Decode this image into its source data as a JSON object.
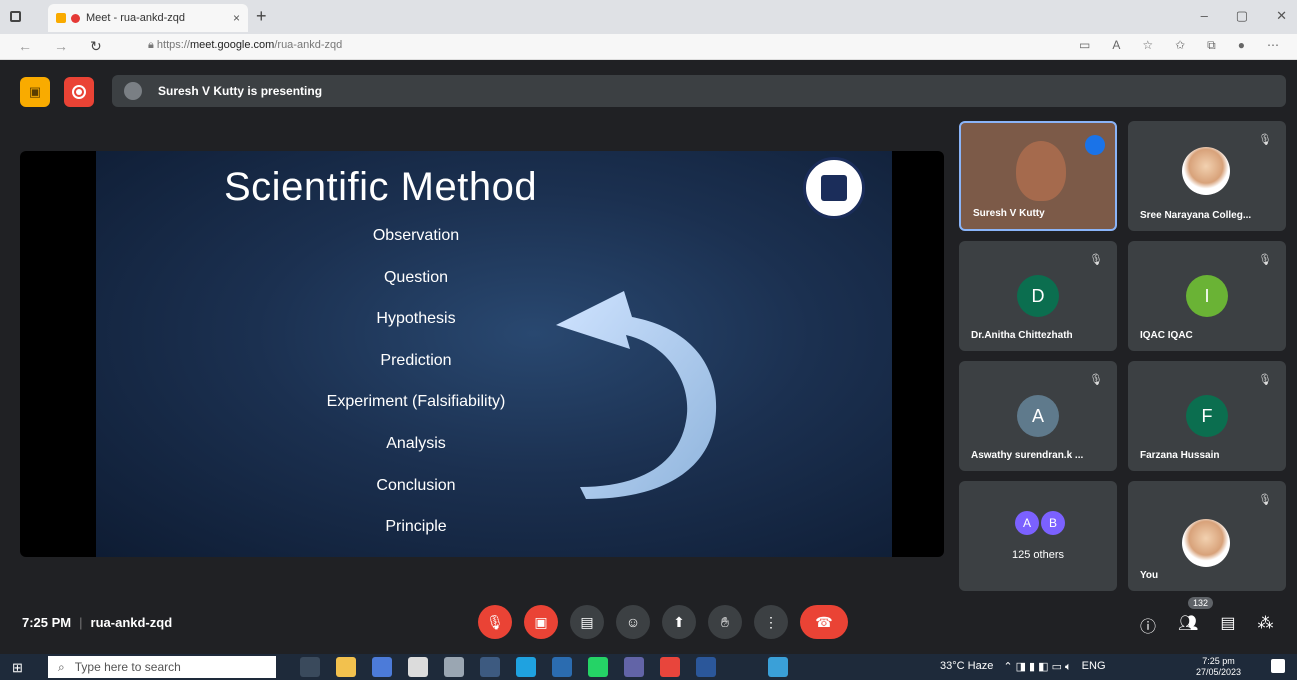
{
  "browser": {
    "tab_title": "Meet - rua-ankd-zqd",
    "tab_close": "×",
    "new_tab": "+",
    "url_prefix": "https://",
    "url_domain": "meet.google.com",
    "url_path": "/rua-ankd-zqd",
    "win_minimize": "–",
    "win_restore": "▢",
    "win_close": "✕"
  },
  "meet": {
    "presenting_text": "Suresh V Kutty is presenting",
    "slide": {
      "title": "Scientific Method",
      "steps": [
        "Observation",
        "Question",
        "Hypothesis",
        "Prediction",
        "Experiment  (Falsifiability)",
        "Analysis",
        "Conclusion",
        "Principle"
      ]
    },
    "participants": [
      {
        "name": "Suresh V Kutty",
        "speaking": true
      },
      {
        "name": "Sree Narayana Colleg...",
        "muted": true
      },
      {
        "name": "Dr.Anitha Chittezhath",
        "initial": "D",
        "color": "#0b6e4f",
        "muted": true
      },
      {
        "name": "IQAC IQAC",
        "initial": "I",
        "color": "#6ab335",
        "muted": true
      },
      {
        "name": "Aswathy surendran.k ...",
        "initial": "A",
        "color": "#5f7a8c",
        "muted": true
      },
      {
        "name": "Farzana Hussain",
        "initial": "F",
        "color": "#0b6e4f",
        "muted": true
      },
      {
        "name": "125 others",
        "initials": [
          "A",
          "B"
        ]
      },
      {
        "name": "You",
        "muted": true
      }
    ],
    "time": "7:25 PM",
    "meeting_code": "rua-ankd-zqd",
    "participant_count": "132"
  },
  "taskbar": {
    "search_placeholder": "Type here to search",
    "weather": "33°C Haze",
    "language": "ENG",
    "clock_time": "7:25 pm",
    "clock_date": "27/05/2023"
  }
}
